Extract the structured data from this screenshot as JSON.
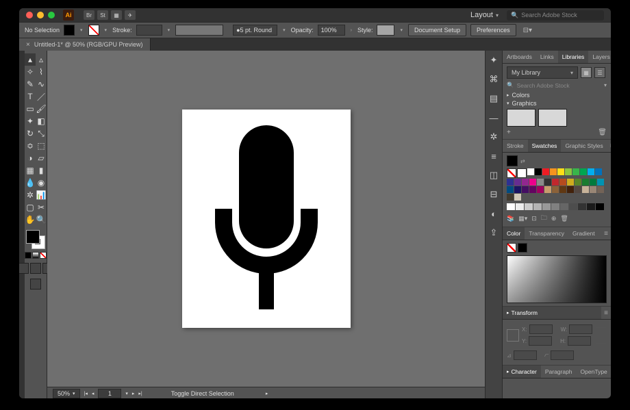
{
  "titlebar": {
    "layout_label": "Layout",
    "search_placeholder": "Search Adobe Stock",
    "logo_text": "Ai",
    "top_icons": [
      "Br",
      "St"
    ]
  },
  "optbar": {
    "selection": "No Selection",
    "stroke_label": "Stroke:",
    "stroke_weight": "",
    "brush_label": "5 pt. Round",
    "opacity_label": "Opacity:",
    "opacity_value": "100%",
    "style_label": "Style:",
    "btn_docsetup": "Document Setup",
    "btn_prefs": "Preferences"
  },
  "doc_tab": {
    "title": "Untitled-1* @ 50% (RGB/GPU Preview)"
  },
  "statusbar": {
    "zoom": "50%",
    "page": "1",
    "tool": "Toggle Direct Selection"
  },
  "panels": {
    "top": {
      "tabs": [
        "Artboards",
        "Links",
        "Libraries",
        "Layers"
      ],
      "active": 2
    },
    "lib": {
      "selector": "My Library",
      "search_placeholder": "Search Adobe Stock",
      "cat_colors": "Colors",
      "cat_graphics": "Graphics"
    },
    "sw": {
      "tabs": [
        "Stroke",
        "Swatches",
        "Graphic Styles"
      ],
      "active": 1,
      "colors": [
        "#ffffff",
        "#000000",
        "#ed1c24",
        "#f7931e",
        "#ffde17",
        "#8dc63f",
        "#39b54a",
        "#00a651",
        "#00aeef",
        "#0072bc",
        "#2e3192",
        "#662d91",
        "#92278f",
        "#ec008c",
        "#898989",
        "#313131",
        "#c1272d",
        "#b54b1f",
        "#cfac1e",
        "#598527",
        "#1a7b30",
        "#007a3d",
        "#0093b2",
        "#004b80",
        "#1b1464",
        "#440e62",
        "#630460",
        "#9e005d",
        "#c69c6d",
        "#8c6239",
        "#603813",
        "#42210b",
        "#534741",
        "#c7b299",
        "#998675",
        "#736357",
        "#413a2e",
        "#d0c8b8"
      ]
    },
    "grays": [
      "#ffffff",
      "#ededed",
      "#cccccc",
      "#b3b3b3",
      "#999999",
      "#808080",
      "#666666",
      "#4d4d4d",
      "#333333",
      "#1a1a1a",
      "#000000"
    ],
    "color": {
      "tabs": [
        "Color",
        "Transparency",
        "Gradient"
      ],
      "active": 0
    },
    "transform": {
      "title": "Transform",
      "x": "X:",
      "y": "Y:",
      "w": "W:",
      "h": "H:"
    },
    "char": {
      "tabs": [
        "Character",
        "Paragraph",
        "OpenType"
      ],
      "active": 0
    }
  }
}
